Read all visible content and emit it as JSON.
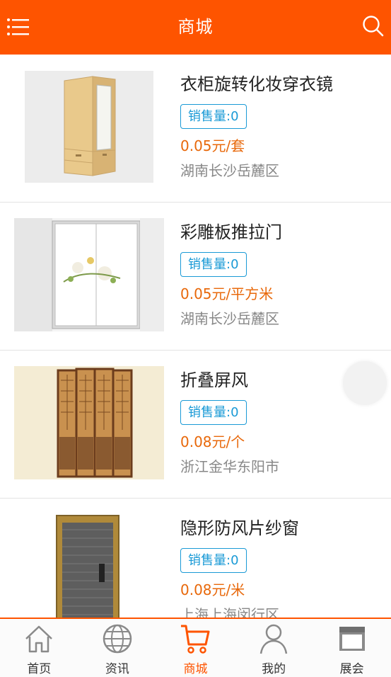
{
  "header": {
    "title": "商城",
    "menu_icon": "menu-icon",
    "search_icon": "search-icon",
    "background": "#fe5400"
  },
  "products": [
    {
      "name": "衣柜旋转化妆穿衣镜",
      "sales": "销售量:0",
      "price": "0.05元/套",
      "location": "湖南长沙岳麓区"
    },
    {
      "name": "彩雕板推拉门",
      "sales": "销售量:0",
      "price": "0.05元/平方米",
      "location": "湖南长沙岳麓区"
    },
    {
      "name": "折叠屏风",
      "sales": "销售量:0",
      "price": "0.08元/个",
      "location": "浙江金华东阳市"
    },
    {
      "name": "隐形防风片纱窗",
      "sales": "销售量:0",
      "price": "0.08元/米",
      "location": "上海上海闵行区"
    }
  ],
  "tabbar": {
    "items": [
      {
        "label": "首页",
        "icon": "home-icon"
      },
      {
        "label": "资讯",
        "icon": "globe-icon"
      },
      {
        "label": "商城",
        "icon": "cart-icon",
        "active": true
      },
      {
        "label": "我的",
        "icon": "user-icon"
      },
      {
        "label": "展会",
        "icon": "store-icon"
      }
    ]
  },
  "colors": {
    "accent": "#fe5400",
    "price": "#e8680a",
    "badge": "#1a9ad6",
    "location": "#888888"
  }
}
